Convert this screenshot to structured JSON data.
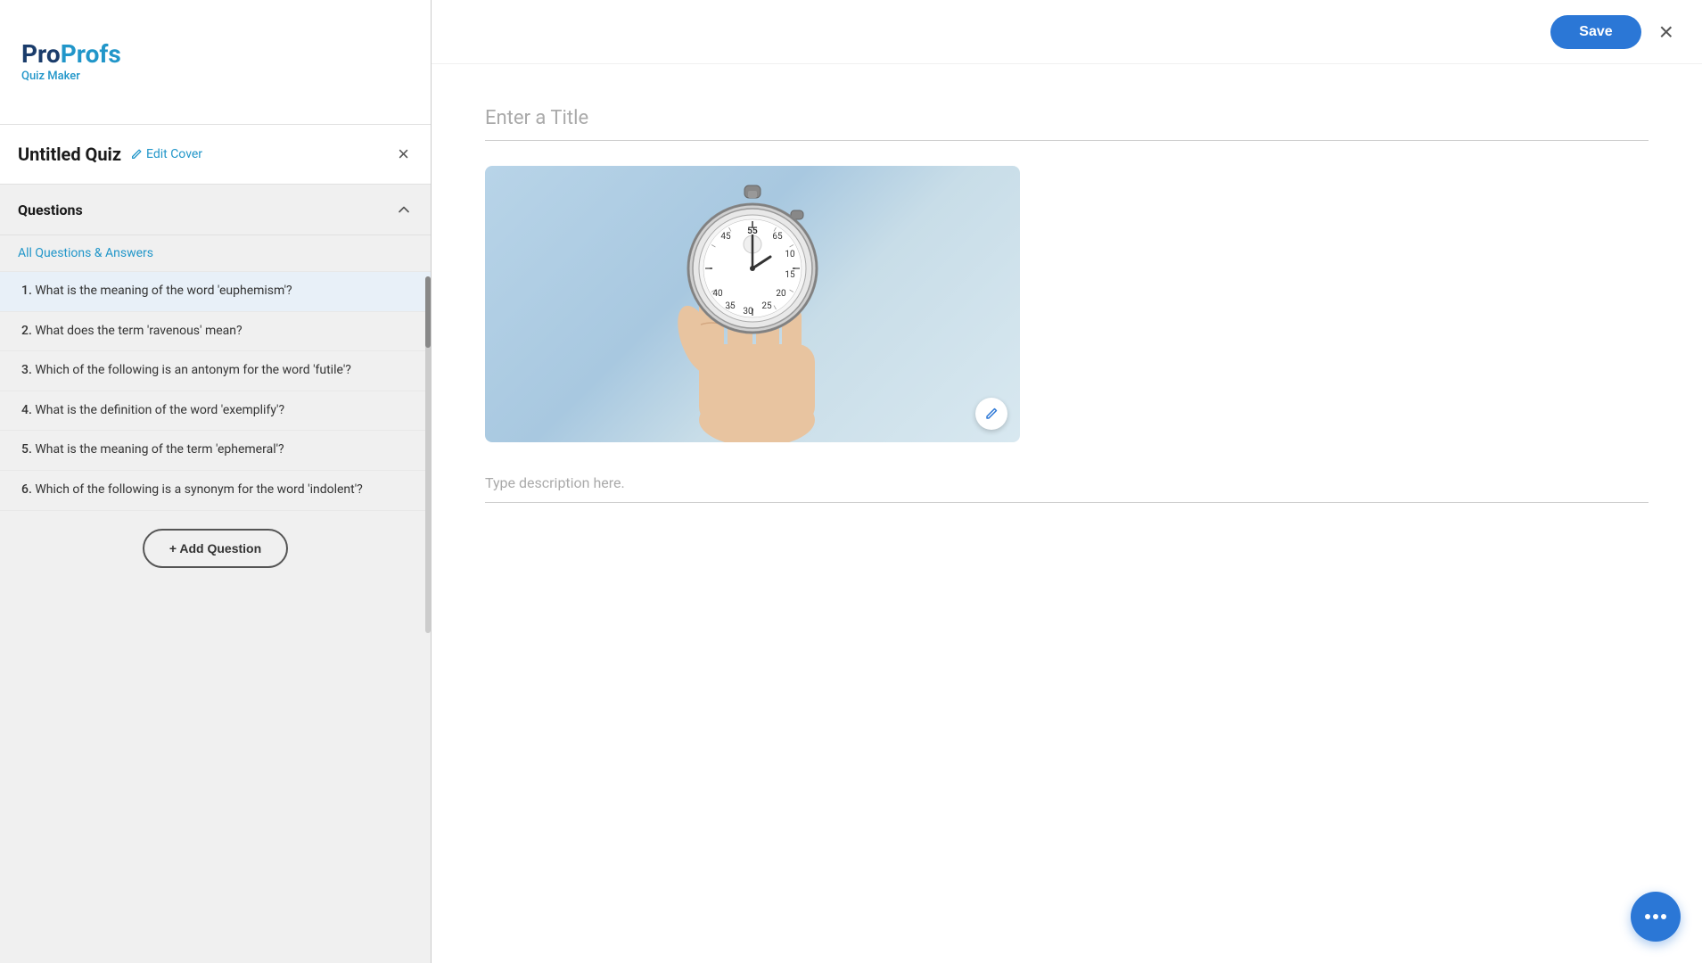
{
  "logo": {
    "pro": "Pro",
    "profs": "Profs",
    "subtitle": "Quiz Maker"
  },
  "sidebar": {
    "quiz_title": "Untitled Quiz",
    "edit_cover_label": "Edit Cover",
    "close_label": "×",
    "questions_label": "Questions",
    "all_questions_label": "All Questions & Answers",
    "questions": [
      {
        "number": "1.",
        "text": "What is the meaning of the word 'euphemism'?"
      },
      {
        "number": "2.",
        "text": "What does the term 'ravenous' mean?"
      },
      {
        "number": "3.",
        "text": "Which of the following is an antonym for the word 'futile'?"
      },
      {
        "number": "4.",
        "text": "What is the definition of the word 'exemplify'?"
      },
      {
        "number": "5.",
        "text": "What is the meaning of the term 'ephemeral'?"
      },
      {
        "number": "6.",
        "text": "Which of the following is a synonym for the word 'indolent'?"
      }
    ],
    "add_question_label": "+ Add Question"
  },
  "modal": {
    "save_label": "Save",
    "close_label": "×",
    "title_placeholder": "Enter a Title",
    "description_placeholder": "Type description here.",
    "edit_image_icon": "✏"
  }
}
